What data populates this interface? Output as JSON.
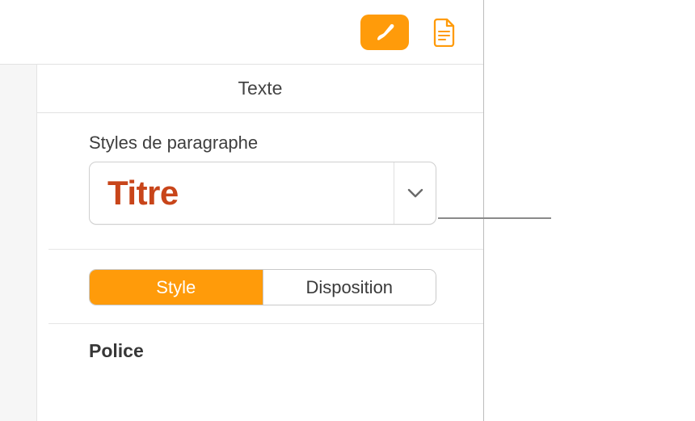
{
  "header": {
    "title": "Texte"
  },
  "paragraph_styles": {
    "label": "Styles de paragraphe",
    "selected": "Titre"
  },
  "segmented": {
    "style": "Style",
    "disposition": "Disposition"
  },
  "font": {
    "label": "Police"
  },
  "colors": {
    "accent": "#ff9b0a",
    "title_text": "#c8451a"
  }
}
